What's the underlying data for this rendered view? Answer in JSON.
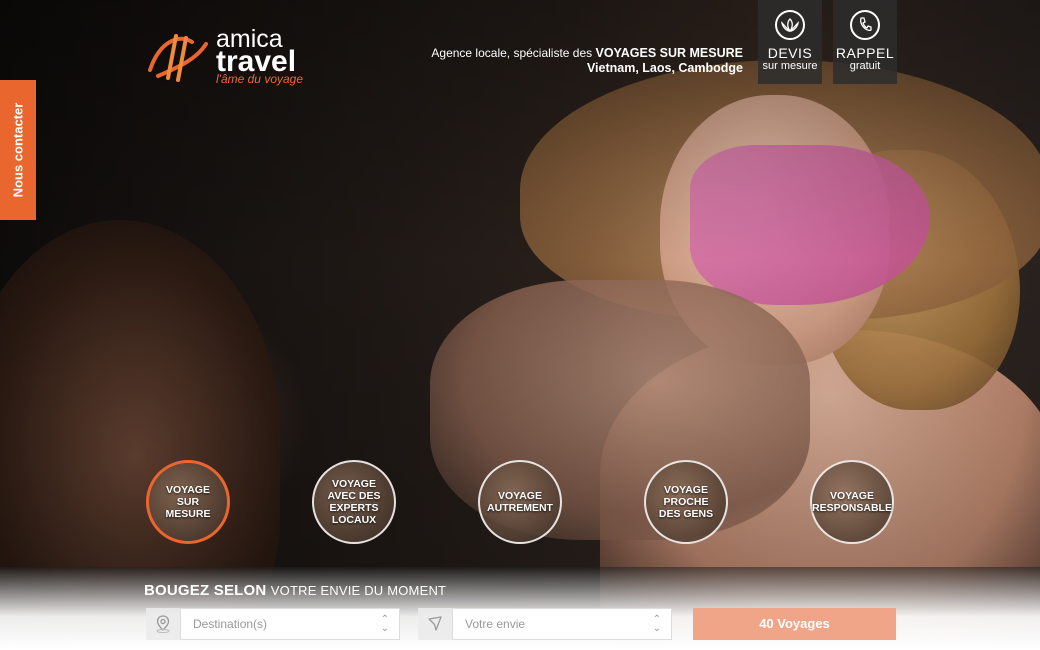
{
  "brand": {
    "name_top": "amica",
    "name_bottom": "travel",
    "tagline": "l'âme du voyage",
    "accent_color": "#e9662f"
  },
  "header": {
    "tag_line1_pre": "Agence locale, spécialiste des ",
    "tag_line1_bold": "VOYAGES SUR MESURE",
    "tag_line2": "Vietnam, Laos, Cambodge",
    "devis": {
      "title": "DEVIS",
      "subtitle": "sur mesure",
      "icon": "lotus-icon"
    },
    "rappel": {
      "title": "RAPPEL",
      "subtitle": "gratuit",
      "icon": "phone-icon"
    }
  },
  "contact_tab": {
    "label": "Nous contacter"
  },
  "categories": [
    {
      "label": "VOYAGE SUR MESURE",
      "active": true
    },
    {
      "label": "VOYAGE AVEC DES EXPERTS LOCAUX",
      "active": false
    },
    {
      "label": "VOYAGE AUTREMENT",
      "active": false
    },
    {
      "label": "VOYAGE PROCHE DES GENS",
      "active": false
    },
    {
      "label": "VOYAGE RESPONSABLE",
      "active": false
    }
  ],
  "search": {
    "title_bold": "BOUGEZ SELON",
    "title_rest": "VOTRE ENVIE DU MOMENT",
    "destination_placeholder": "Destination(s)",
    "envie_placeholder": "Votre envie",
    "submit_label": "40 Voyages",
    "destination_icon": "map-pin-icon",
    "envie_icon": "navigation-arrow-icon"
  }
}
